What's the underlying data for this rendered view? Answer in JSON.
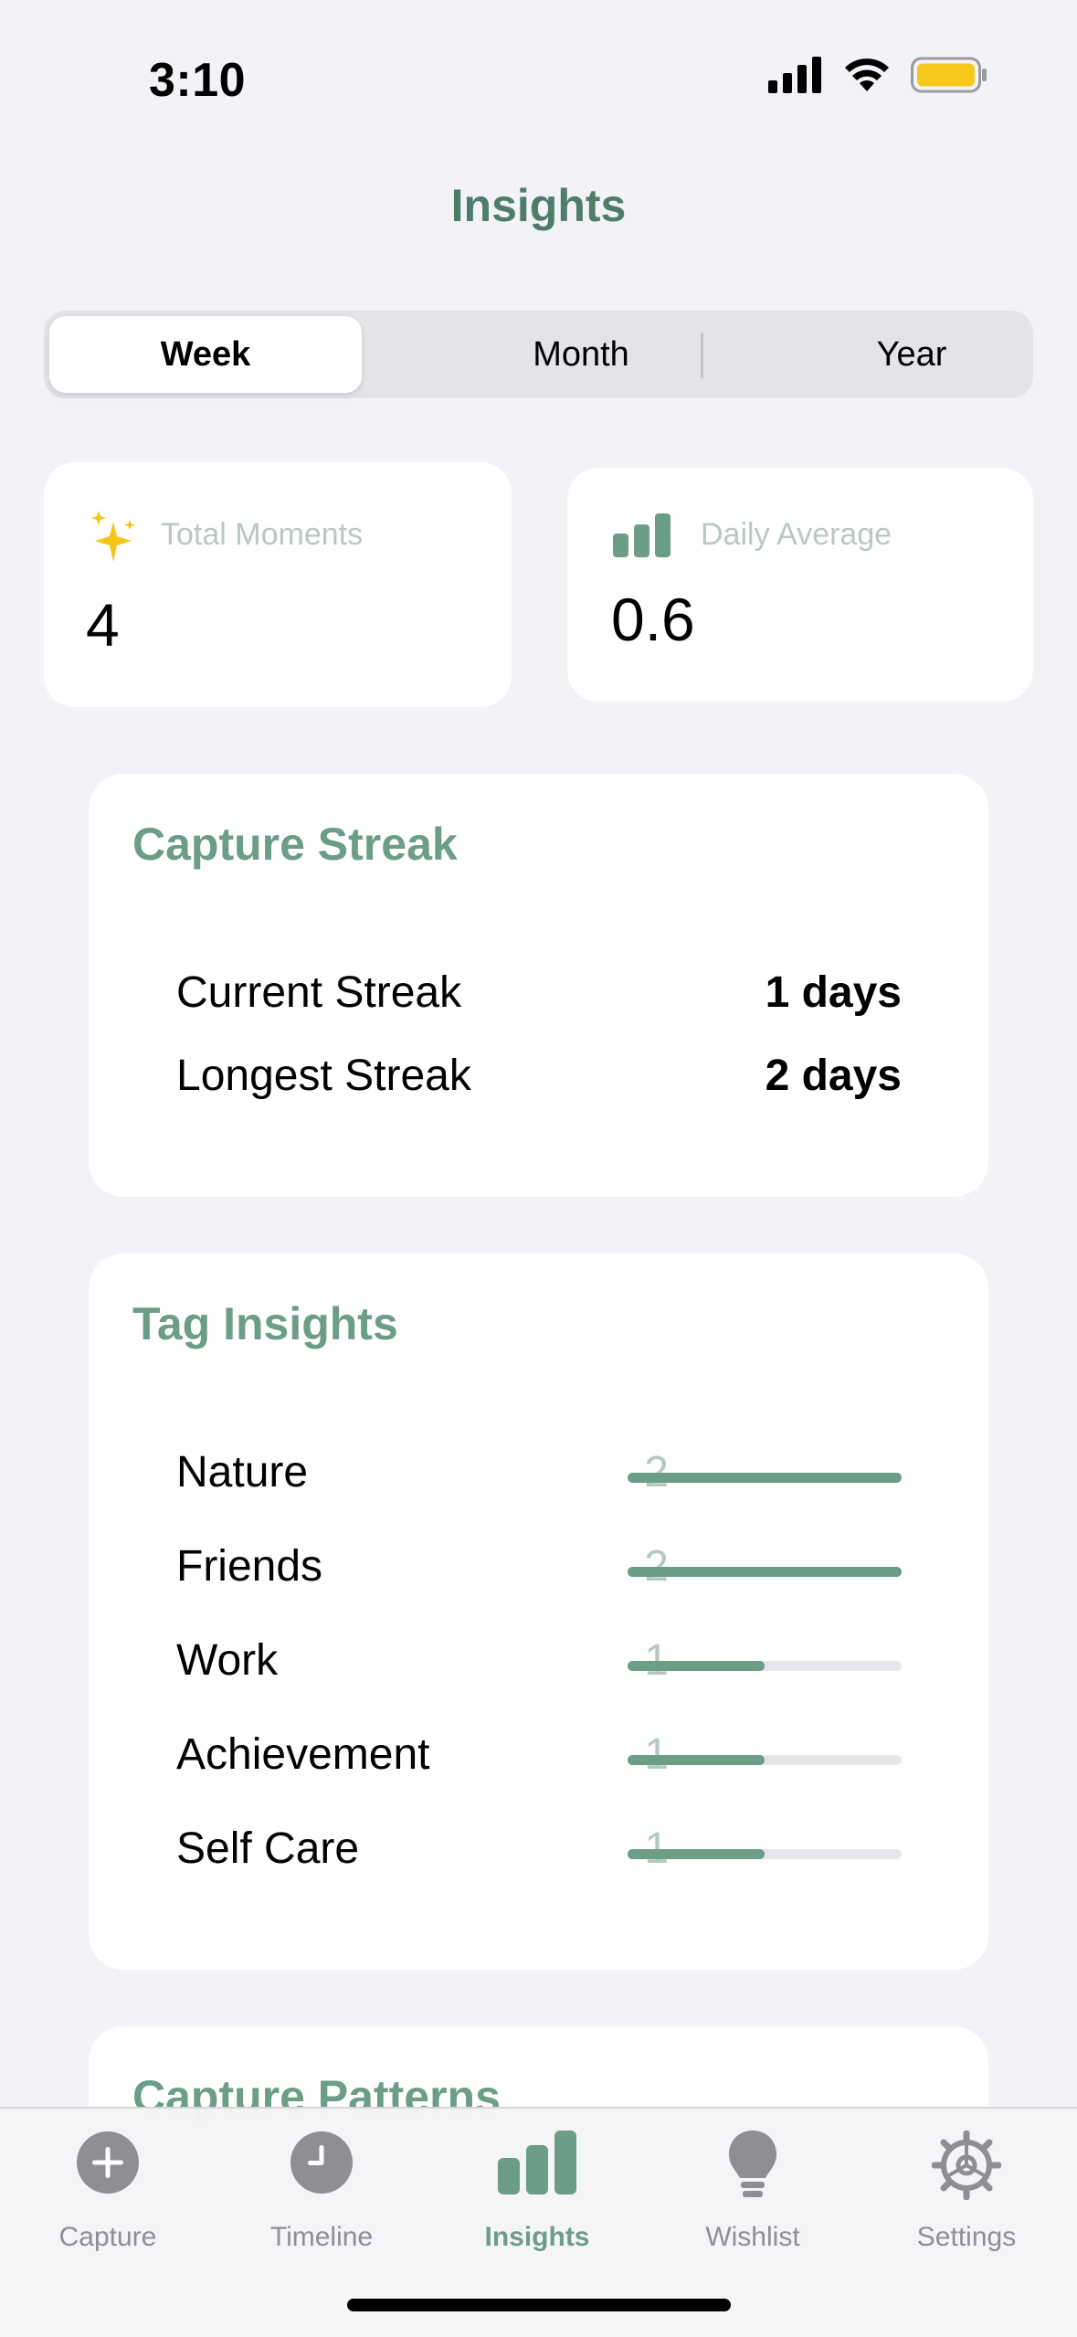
{
  "status_bar": {
    "time": "3:10",
    "battery_color": "#f7c81b"
  },
  "nav": {
    "title": "Insights"
  },
  "segments": {
    "week": "Week",
    "month": "Month",
    "year": "Year",
    "selected": "Week"
  },
  "stats": {
    "total_moments": {
      "label": "Total Moments",
      "value": "4",
      "icon": "sparkles-icon"
    },
    "daily_average": {
      "label": "Daily Average",
      "value": "0.6",
      "icon": "bar-chart-icon"
    }
  },
  "streak": {
    "title": "Capture Streak",
    "current_label": "Current Streak",
    "current_value": "1 days",
    "longest_label": "Longest Streak",
    "longest_value": "2 days"
  },
  "tags": {
    "title": "Tag Insights",
    "items": [
      {
        "name": "Nature",
        "count": "2",
        "fraction": 1.0
      },
      {
        "name": "Friends",
        "count": "2",
        "fraction": 1.0
      },
      {
        "name": "Work",
        "count": "1",
        "fraction": 0.5
      },
      {
        "name": "Achievement",
        "count": "1",
        "fraction": 0.5
      },
      {
        "name": "Self Care",
        "count": "1",
        "fraction": 0.5
      }
    ]
  },
  "patterns": {
    "title": "Capture Patterns"
  },
  "tabbar": {
    "items": [
      {
        "label": "Capture",
        "icon": "plus-circle-icon"
      },
      {
        "label": "Timeline",
        "icon": "clock-icon"
      },
      {
        "label": "Insights",
        "icon": "bar-chart-icon"
      },
      {
        "label": "Wishlist",
        "icon": "lightbulb-icon"
      },
      {
        "label": "Settings",
        "icon": "gear-icon"
      }
    ],
    "selected": "Insights"
  },
  "colors": {
    "accent": "#6b9d87",
    "title": "#4e7d6a",
    "background": "#f2f2f7",
    "inactive": "#8e8e93"
  }
}
